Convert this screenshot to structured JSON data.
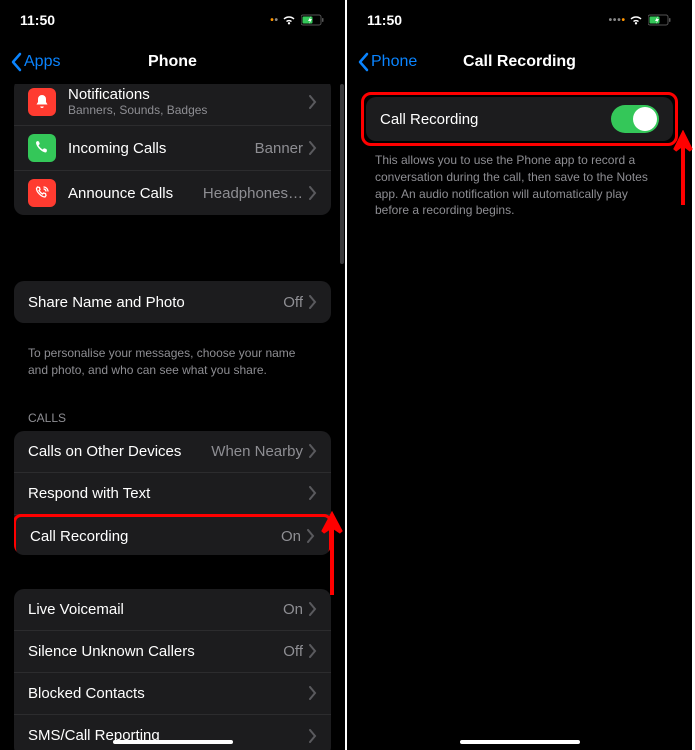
{
  "left": {
    "status": {
      "time": "11:50"
    },
    "nav": {
      "back": "Apps",
      "title": "Phone"
    },
    "group1": [
      {
        "label": "Notifications",
        "sub": "Banners, Sounds, Badges",
        "icon": "bell",
        "iconColor": "red"
      },
      {
        "label": "Incoming Calls",
        "value": "Banner",
        "icon": "phone",
        "iconColor": "green"
      },
      {
        "label": "Announce Calls",
        "value": "Headphones…",
        "icon": "announce",
        "iconColor": "red"
      }
    ],
    "group2": [
      {
        "label": "Share Name and Photo",
        "value": "Off"
      }
    ],
    "group2_footer": "To personalise your messages, choose your name and photo, and who can see what you share.",
    "calls_header": "CALLS",
    "group3": [
      {
        "label": "Calls on Other Devices",
        "value": "When Nearby"
      },
      {
        "label": "Respond with Text",
        "value": ""
      },
      {
        "label": "Call Recording",
        "value": "On",
        "highlight": true
      }
    ],
    "group4": [
      {
        "label": "Live Voicemail",
        "value": "On"
      },
      {
        "label": "Silence Unknown Callers",
        "value": "Off"
      },
      {
        "label": "Blocked Contacts",
        "value": ""
      },
      {
        "label": "SMS/Call Reporting",
        "value": ""
      }
    ]
  },
  "right": {
    "status": {
      "time": "11:50"
    },
    "nav": {
      "back": "Phone",
      "title": "Call Recording"
    },
    "row": {
      "label": "Call Recording",
      "on": true
    },
    "footer": "This allows you to use the Phone app to record a conversation during the call, then save to the Notes app. An audio notification will automatically play before a recording begins."
  }
}
